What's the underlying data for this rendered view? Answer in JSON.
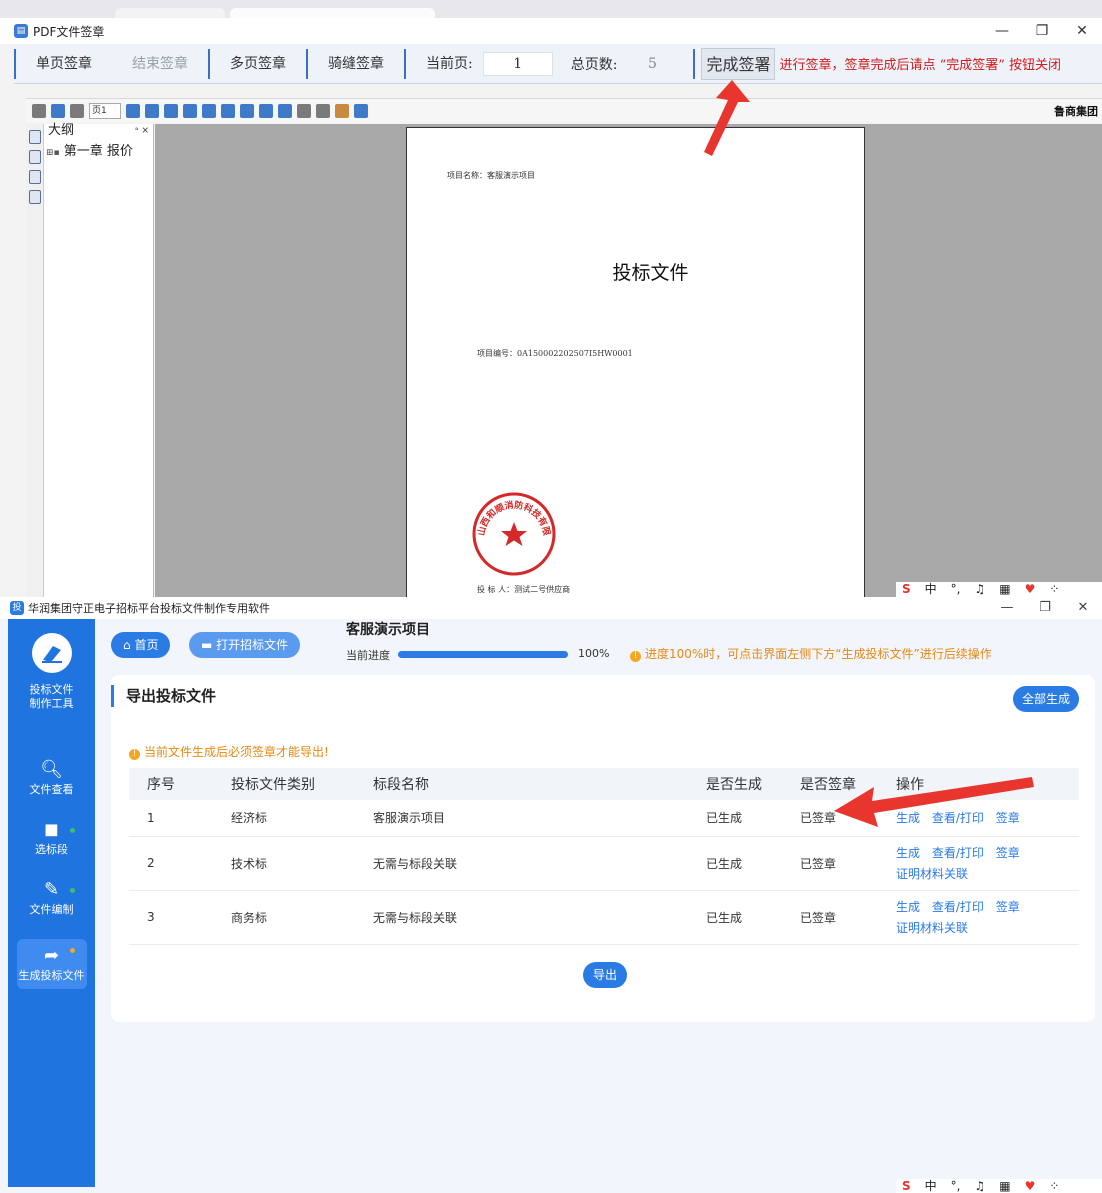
{
  "pdf_window": {
    "title": "PDF文件签章",
    "window_controls": [
      "—",
      "❐",
      "✕"
    ],
    "toolbar": {
      "single_sign": "单页签章",
      "end_sign": "结束签章",
      "multi_sign": "多页签章",
      "seam_sign": "骑缝签章",
      "current_page_label": "当前页:",
      "current_page": "1",
      "total_pages_label": "总页数:",
      "total_pages": "5",
      "complete_button": "完成签署",
      "notice": "进行签章，签章完成后请点 “完成签署” 按钮关闭"
    },
    "icon_toolbar": {
      "page_select": "页1",
      "brand": "鲁商集团"
    },
    "outline": {
      "header": "大纲",
      "pin": "ᵃ ×",
      "item": "第一章  报价"
    },
    "page": {
      "project_name": "项目名称：客服演示项目",
      "title": "投标文件",
      "project_code": "项目编号：0A150002202507I5HW0001",
      "seal_text": "山西和顺消防科技有限公司",
      "bidder": "投 标 人：测试二号供应商"
    },
    "ime": [
      "中",
      "°,",
      "♫",
      "▦",
      "♥",
      "⁘",
      "✿"
    ]
  },
  "bid_window": {
    "title": "华润集团守正电子招标平台投标文件制作专用软件",
    "window_controls": [
      "—",
      "❐",
      "✕"
    ],
    "sidebar": {
      "logo_text": "投标文件\n制作工具",
      "items": [
        {
          "label": "文件查看",
          "icon": "search-doc-icon"
        },
        {
          "label": "选标段",
          "icon": "cube-icon"
        },
        {
          "label": "文件编制",
          "icon": "pen-icon"
        },
        {
          "label": "生成投标文件",
          "icon": "share-icon"
        }
      ]
    },
    "header": {
      "home": "首页",
      "open": "打开招标文件",
      "project_title": "客服演示项目",
      "progress_label": "当前进度",
      "progress_value": 1.0,
      "progress_text": "100%",
      "progress_tip": "进度100%时，可点击界面左侧下方“生成投标文件”进行后续操作"
    },
    "card": {
      "title": "导出投标文件",
      "generate_all": "全部生成",
      "warning": "当前文件生成后必须签章才能导出!",
      "columns": [
        "序号",
        "投标文件类别",
        "标段名称",
        "是否生成",
        "是否签章",
        "操作"
      ],
      "rows": [
        {
          "no": "1",
          "category": "经济标",
          "section": "客服演示项目",
          "generated": "已生成",
          "signed": "已签章",
          "ops": [
            "生成",
            "查看/打印",
            "签章"
          ],
          "ops2": ""
        },
        {
          "no": "2",
          "category": "技术标",
          "section": "无需与标段关联",
          "generated": "已生成",
          "signed": "已签章",
          "ops": [
            "生成",
            "查看/打印",
            "签章"
          ],
          "ops2": "证明材料关联"
        },
        {
          "no": "3",
          "category": "商务标",
          "section": "无需与标段关联",
          "generated": "已生成",
          "signed": "已签章",
          "ops": [
            "生成",
            "查看/打印",
            "签章"
          ],
          "ops2": "证明材料关联"
        }
      ],
      "export": "导出"
    },
    "ime": [
      "中",
      "°,",
      "♫",
      "▦",
      "♥",
      "⁘",
      "✿"
    ]
  },
  "colors": {
    "accent": "#2a7be4",
    "sidebar": "#1f74e0",
    "warning": "#e58a14",
    "notice_red": "#d31a1a",
    "arrow": "#e8352e"
  }
}
